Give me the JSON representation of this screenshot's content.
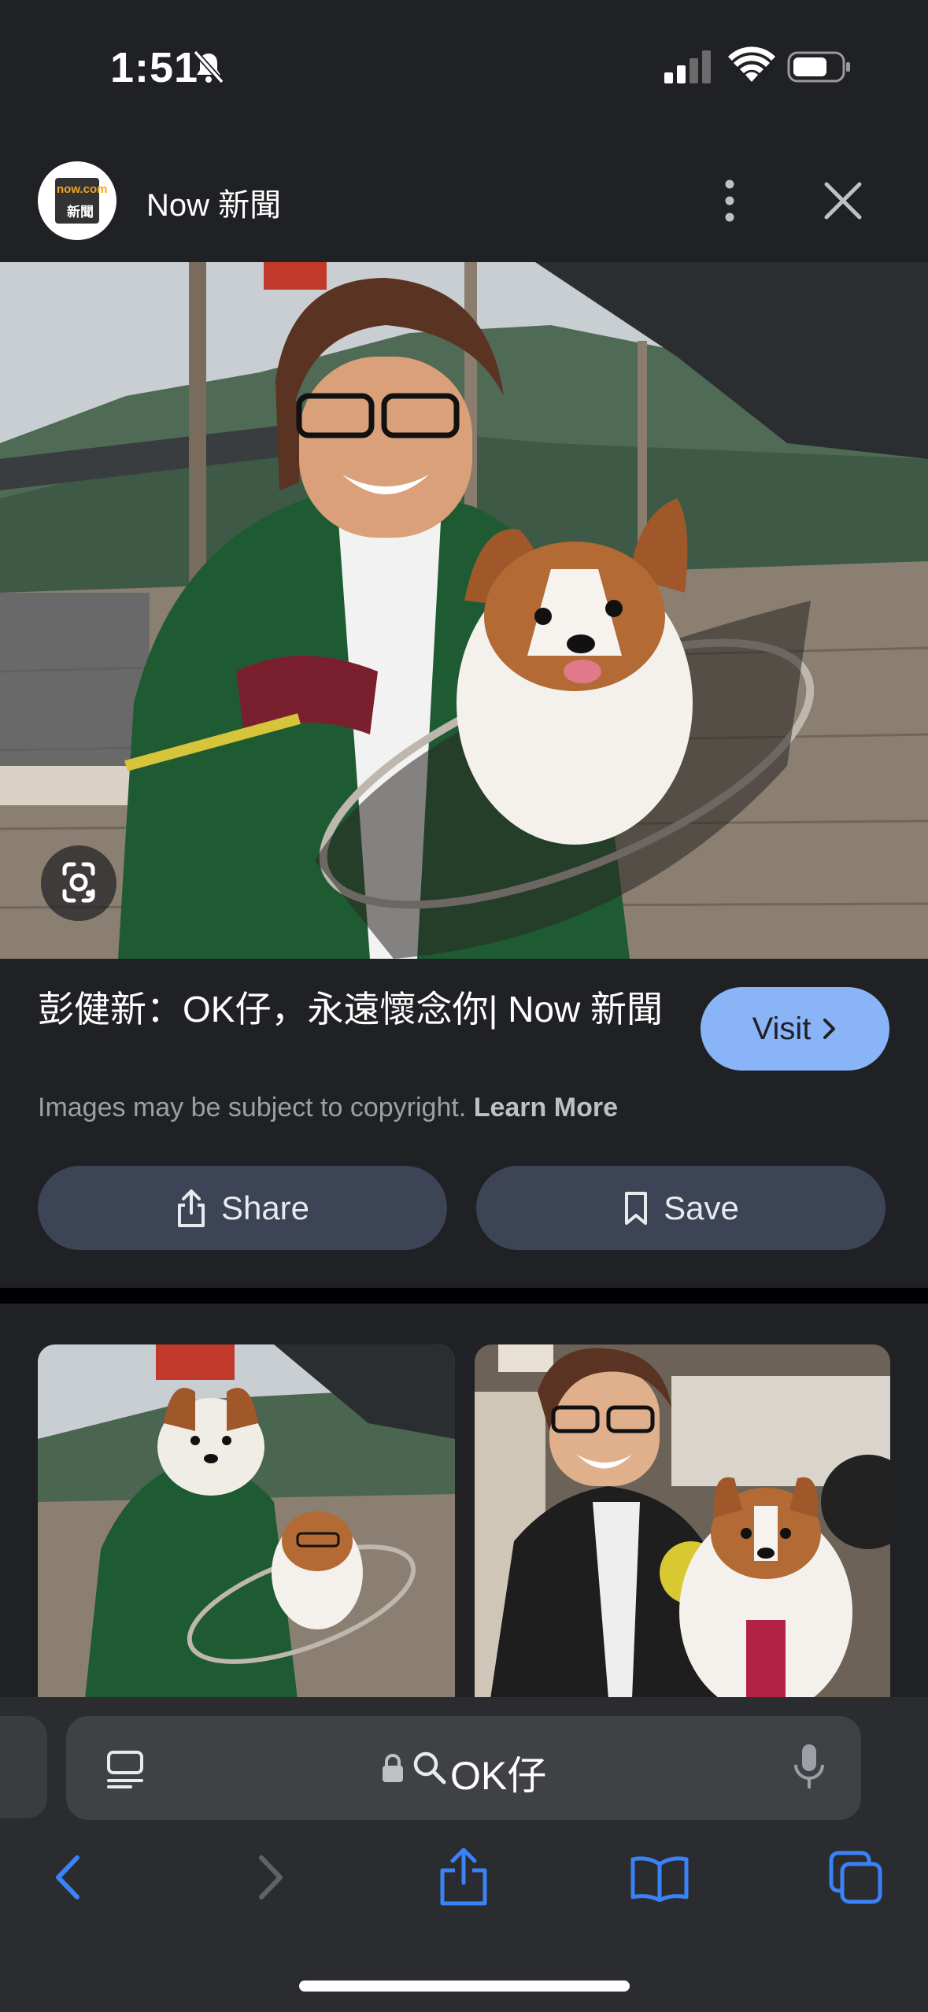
{
  "status_bar": {
    "time": "1:51"
  },
  "header": {
    "source_name": "Now 新聞",
    "logo_top": "now.com",
    "logo_bottom": "新聞"
  },
  "result": {
    "title": "彭健新：OK仔，永遠懷念你| Now 新聞",
    "visit_label": "Visit",
    "copyright_text": "Images may be subject to copyright.",
    "learn_more_label": "Learn More",
    "share_label": "Share",
    "save_label": "Save"
  },
  "browser": {
    "address_text": "OK仔"
  },
  "icons": {
    "bell_muted": "bell-slash-icon",
    "more": "more-vert-icon",
    "close": "close-icon",
    "lens": "google-lens-icon",
    "share": "share-icon",
    "save": "bookmark-icon",
    "reader": "reader-mode-icon",
    "lock": "lock-icon",
    "search": "search-icon",
    "mic": "mic-icon",
    "back": "back-icon",
    "forward": "forward-icon",
    "bookmarks": "book-icon",
    "tabs": "tabs-icon"
  },
  "colors": {
    "background": "#202124",
    "accent_button": "#8ab4f8",
    "action_button": "#3c4456",
    "ios_blue": "#3a82f7"
  }
}
